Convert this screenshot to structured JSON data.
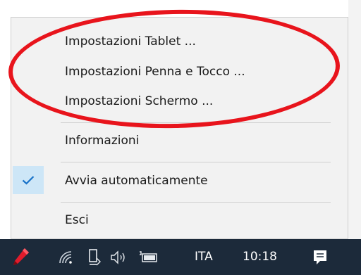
{
  "context_menu": {
    "items": [
      {
        "label": "Impostazioni Tablet ..."
      },
      {
        "label": "Impostazioni Penna e Tocco ..."
      },
      {
        "label": "Impostazioni Schermo ..."
      },
      {
        "label": "Informazioni"
      },
      {
        "label": "Avvia automaticamente",
        "checked": true
      },
      {
        "label": "Esci"
      }
    ]
  },
  "annotation": {
    "color": "#e8141c",
    "shape": "ellipse"
  },
  "taskbar": {
    "language": "ITA",
    "clock": "10:18",
    "icons": [
      "pen-app-icon",
      "wifi-icon",
      "usb-device-icon",
      "volume-icon",
      "battery-icon",
      "action-center-icon"
    ]
  },
  "colors": {
    "menu_bg": "#f2f2f2",
    "taskbar_bg": "#1c2a3a",
    "check_highlight": "#cde6f7",
    "check": "#1a73c9",
    "pen": "#e01b2b"
  }
}
